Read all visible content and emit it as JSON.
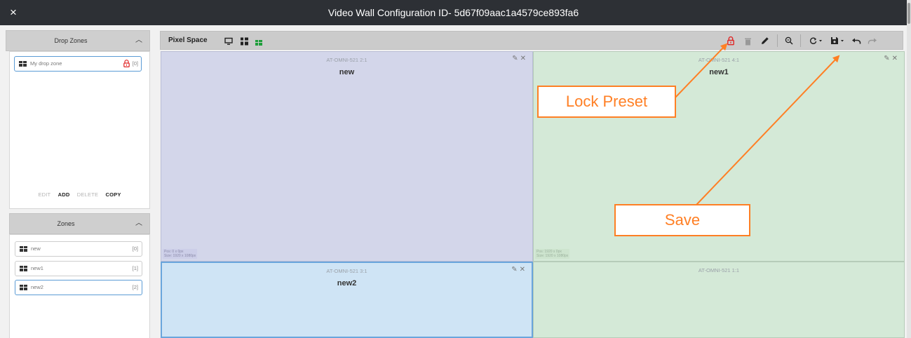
{
  "window": {
    "title": "Video Wall Configuration ID- 5d67f09aac1a4579ce893fa6",
    "close_label": "×"
  },
  "drop_zones": {
    "header": "Drop Zones",
    "item": {
      "label": "My drop zone",
      "count": "[0]"
    },
    "actions": {
      "edit": "EDIT",
      "add": "ADD",
      "delete": "DELETE",
      "copy": "COPY"
    }
  },
  "zones": {
    "header": "Zones",
    "items": [
      {
        "label": "new",
        "count": "[0]"
      },
      {
        "label": "new1",
        "count": "[1]"
      },
      {
        "label": "new2",
        "count": "[2]"
      }
    ]
  },
  "toolbar": {
    "title": "Pixel Space",
    "icons": [
      "monitor-icon",
      "grid-icon",
      "green-grid-icon",
      "lock-icon",
      "trash-icon",
      "pencil-icon",
      "zoom-icon",
      "refresh-icon",
      "save-icon",
      "undo-icon",
      "redo-icon"
    ]
  },
  "canvas": {
    "cells": [
      {
        "display": "AT-OMNI-521 2:1",
        "zone": "new",
        "pos": "Pos: 0 x 0px",
        "size": "Size: 1920 x 1080px",
        "color": "#d3d6ea"
      },
      {
        "display": "AT-OMNI-521 4:1",
        "zone": "new1",
        "pos": "Pos: 1920 x 0px",
        "size": "Size: 1920 x 1080px",
        "color": "#d4e9d7"
      },
      {
        "display": "AT-OMNI-521 3:1",
        "zone": "new2",
        "color": "#cfe4f5"
      },
      {
        "display": "AT-OMNI-521 1:1",
        "zone": "",
        "color": "#d4e9d7"
      }
    ]
  },
  "annotations": {
    "lock_preset": "Lock Preset",
    "save": "Save",
    "color": "#ff7f24"
  }
}
